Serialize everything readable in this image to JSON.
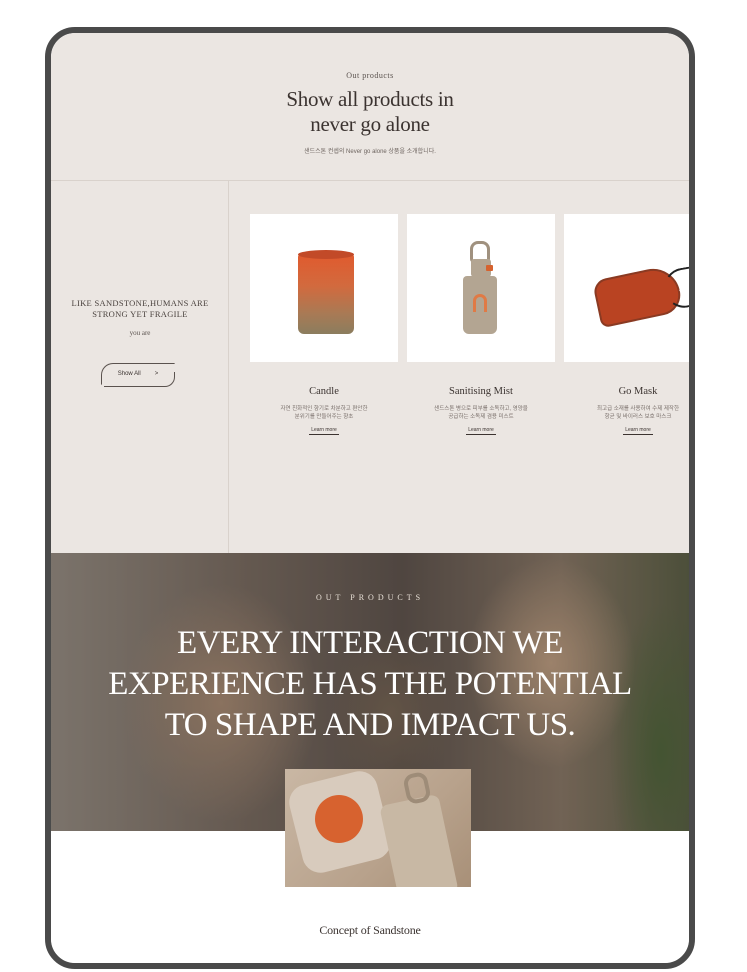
{
  "header": {
    "eyebrow": "Out products",
    "title_line1": "Show all products in",
    "title_line2": "never go alone",
    "subtitle": "샌드스톤 컨셉의 Never go alone 상품을 소개합니다."
  },
  "intro": {
    "tagline_line1": "LIKE SANDSTONE,HUMANS ARE",
    "tagline_line2": "STRONG YET FRAGILE",
    "sub": "you are",
    "show_all_label": "Show All",
    "show_all_arrow": ">"
  },
  "products": [
    {
      "name": "Candle",
      "desc_line1": "자연 친화적인 향기로 차분하고 편안한",
      "desc_line2": "분위기를 만들어주는 향초",
      "more": "Learn more",
      "icon": "candle-image"
    },
    {
      "name": "Sanitising Mist",
      "desc_line1": "샌드스톤 병으로 피부를 소독하고, 영양을",
      "desc_line2": "공급하는 소독제 겸용 미스트",
      "more": "Learn more",
      "icon": "mist-bottle-image"
    },
    {
      "name": "Go Mask",
      "desc_line1": "최고급 소재를 사용하여 수제 제작한",
      "desc_line2": "항균 및 바이러스 보호 마스크",
      "more": "Learn more",
      "icon": "mask-image"
    }
  ],
  "carousel": {
    "next_icon": "chevron-right-icon",
    "next_glyph": "›"
  },
  "banner": {
    "eyebrow": "OUT PRODUCTS",
    "line1": "EVERY INTERACTION WE",
    "line2": "EXPERIENCE HAS THE POTENTIAL",
    "line3": "TO SHAPE AND IMPACT US."
  },
  "concept": {
    "title": "Concept of Sandstone"
  },
  "colors": {
    "background": "#ebe6e2",
    "accent": "#d7622f",
    "text": "#3b3330"
  }
}
